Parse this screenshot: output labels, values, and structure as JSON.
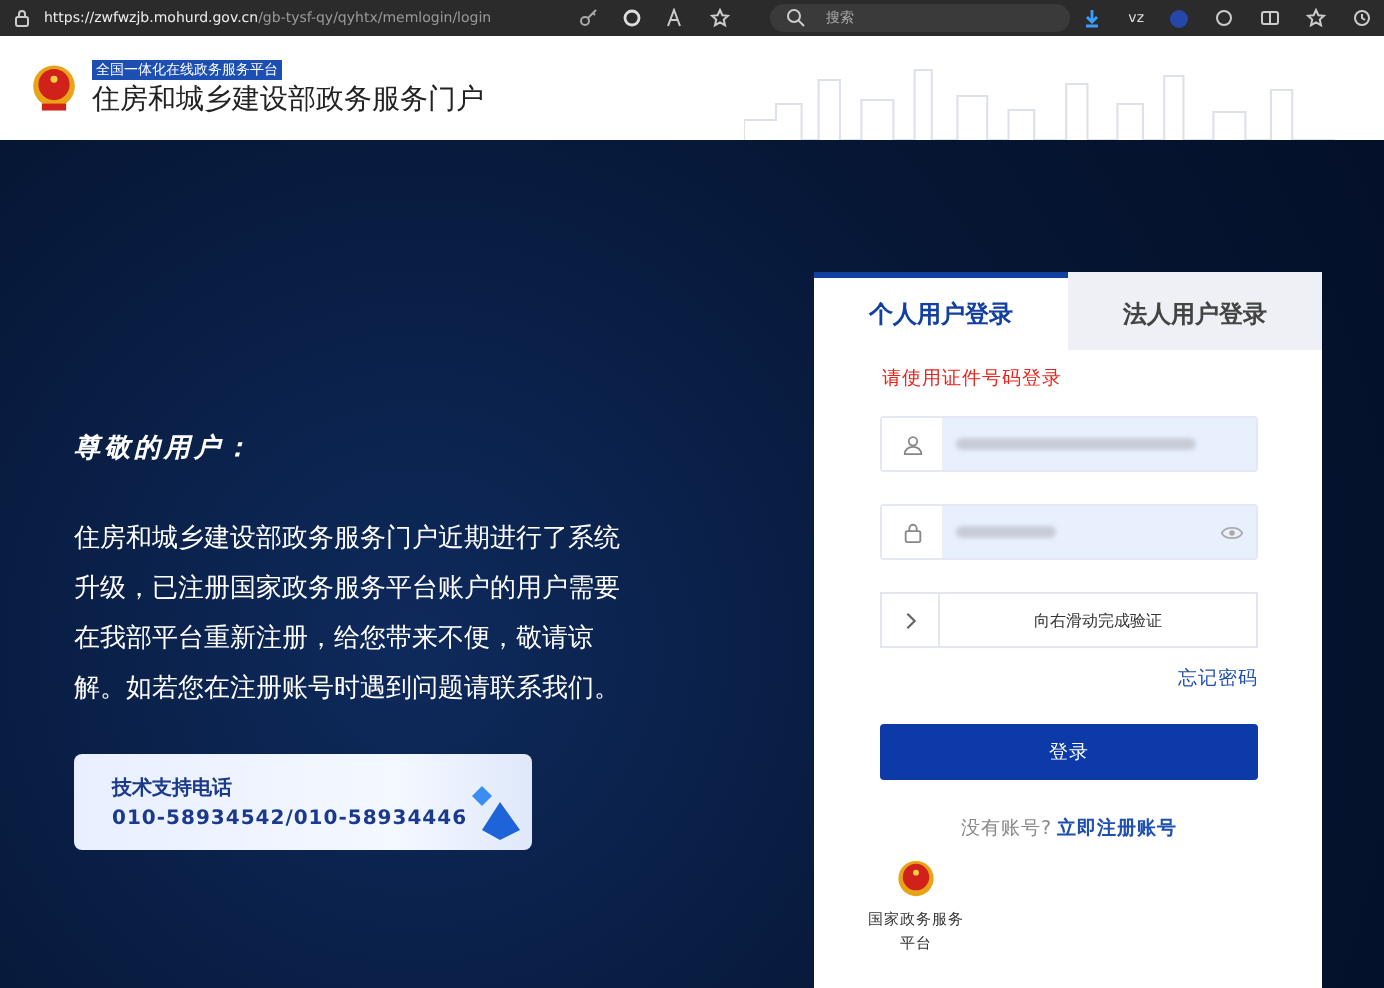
{
  "browser": {
    "url_host": "https://zwfwzjb.mohurd.gov.cn",
    "url_path": "/gb-tysf-qy/qyhtx/memlogin/login",
    "search_placeholder": "搜索",
    "profile_label": "vz"
  },
  "header": {
    "tagline": "全国一体化在线政务服务平台",
    "title": "住房和城乡建设部政务服务门户"
  },
  "notice": {
    "heading": "尊敬的用户：",
    "body": "住房和城乡建设部政务服务门户近期进行了系统升级，已注册国家政务服务平台账户的用户需要在我部平台重新注册，给您带来不便，敬请谅解。如若您在注册账号时遇到问题请联系我们。"
  },
  "support": {
    "label": "技术支持电话",
    "phones": "010-58934542/010-58934446"
  },
  "login": {
    "tabs": [
      {
        "label": "个人用户登录",
        "selected": true
      },
      {
        "label": "法人用户登录",
        "selected": false
      }
    ],
    "hint": "请使用证件号码登录",
    "slider_text": "向右滑动完成验证",
    "forgot": "忘记密码",
    "submit": "登录",
    "no_account": "没有账号?",
    "register": "立即注册账号",
    "alt_login": "国家政务服务平台"
  }
}
